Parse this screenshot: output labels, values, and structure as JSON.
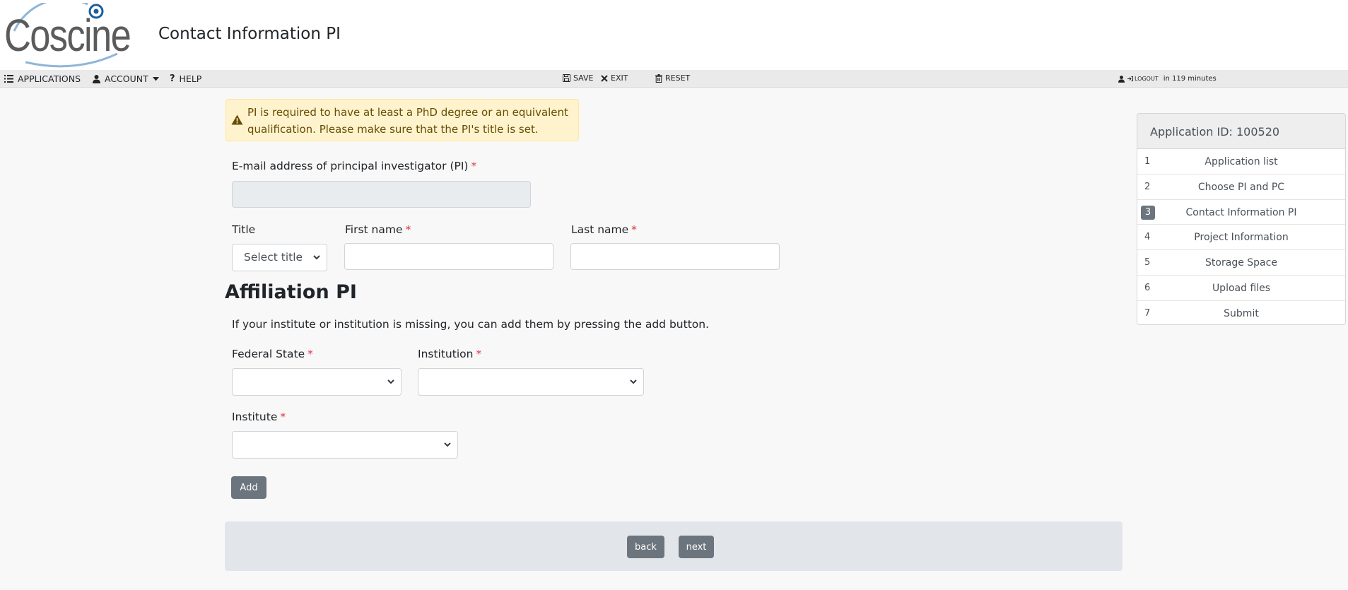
{
  "header": {
    "logo_text": "Coscine",
    "page_title": "Contact Information PI"
  },
  "toolbar": {
    "applications": "APPLICATIONS",
    "account": "ACCOUNT",
    "help": "HELP",
    "save": "SAVE",
    "exit": "EXIT",
    "reset": "RESET",
    "logout": "LOGOUT",
    "session": "in 119 minutes"
  },
  "alert": {
    "text": "PI is required to have at least a PhD degree or an equivalent qualification. Please make sure that the PI's title is set."
  },
  "form": {
    "email_label": "E-mail address of principal investigator (PI)",
    "email_value": "",
    "title_label": "Title",
    "title_value": "Select title",
    "first_name_label": "First name",
    "first_name_value": "",
    "last_name_label": "Last name",
    "last_name_value": "",
    "required_mark": "*"
  },
  "affiliation": {
    "heading": "Affiliation PI",
    "help_text": "If your institute or institution is missing, you can add them by pressing the add button.",
    "federal_state_label": "Federal State",
    "federal_state_value": "",
    "institution_label": "Institution",
    "institution_value": "",
    "institute_label": "Institute",
    "institute_value": "",
    "add_label": "Add"
  },
  "nav": {
    "back_label": "back",
    "next_label": "next"
  },
  "sidebar": {
    "title": "Application ID: 100520",
    "items": [
      {
        "num": "1",
        "label": "Application list",
        "active": false
      },
      {
        "num": "2",
        "label": "Choose PI and PC",
        "active": false
      },
      {
        "num": "3",
        "label": "Contact Information PI",
        "active": true
      },
      {
        "num": "4",
        "label": "Project Information",
        "active": false
      },
      {
        "num": "5",
        "label": "Storage Space",
        "active": false
      },
      {
        "num": "6",
        "label": "Upload files",
        "active": false
      },
      {
        "num": "7",
        "label": "Submit",
        "active": false
      }
    ]
  },
  "colors": {
    "accent": "#6c757d",
    "alert_bg": "#fff3cd",
    "required": "#dc3545",
    "logo_ring": "#1a5e9c"
  }
}
